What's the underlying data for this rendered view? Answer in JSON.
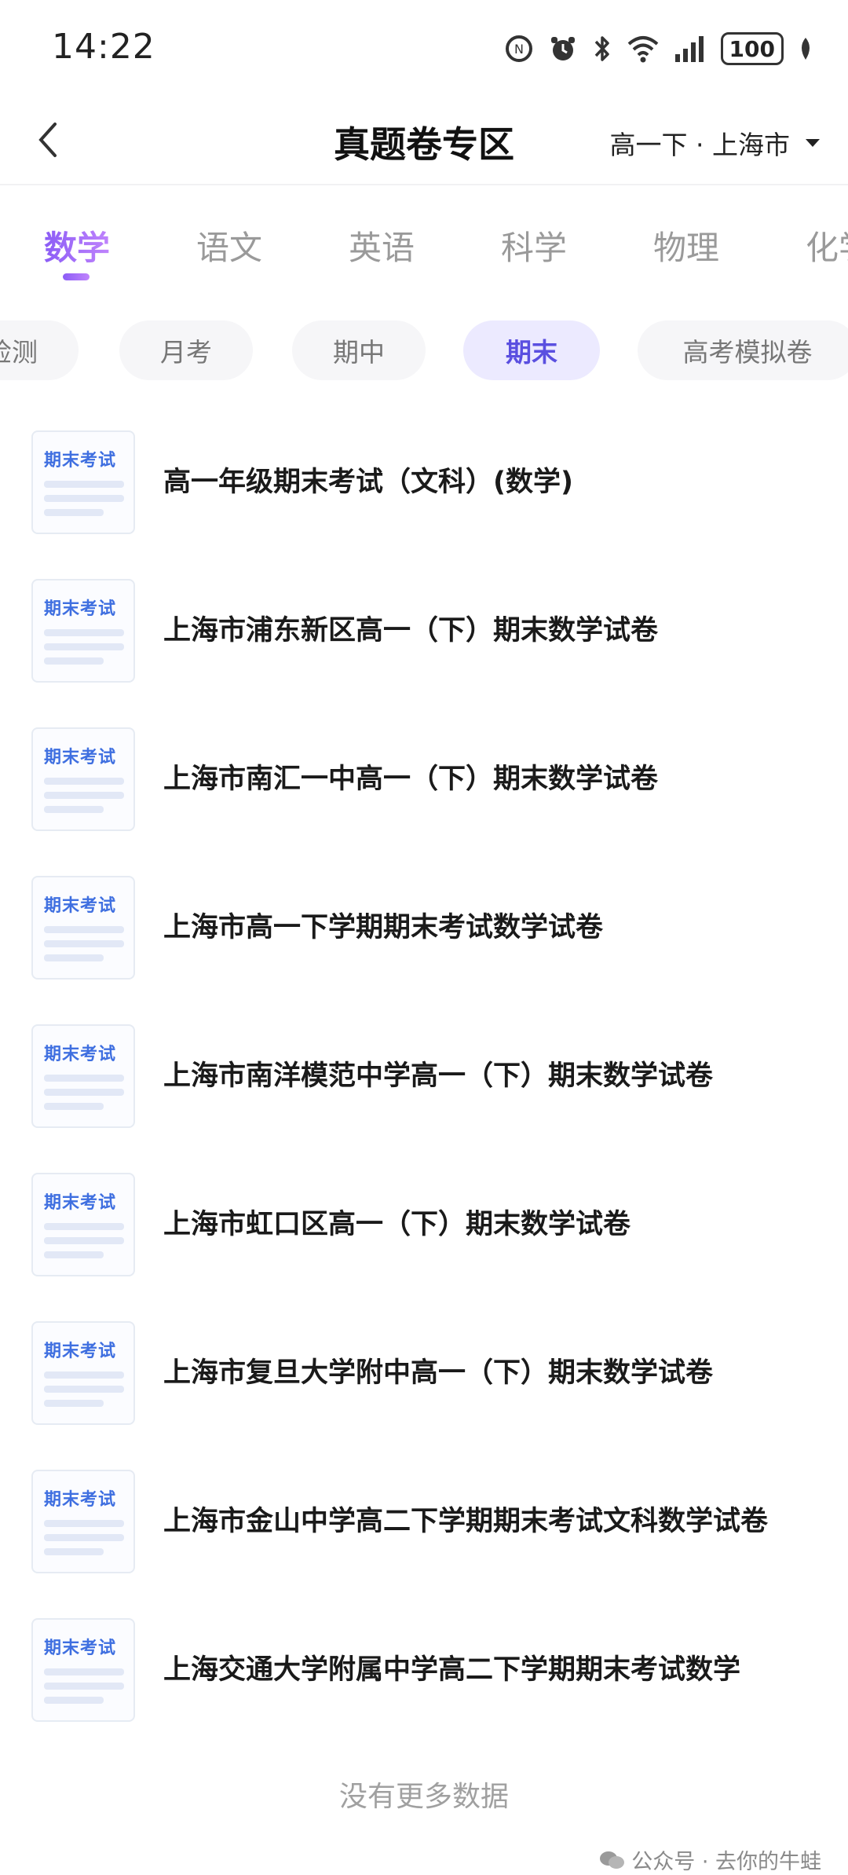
{
  "status_bar": {
    "time": "14:22",
    "battery": "100"
  },
  "header": {
    "title": "真题卷专区",
    "region": "高一下 · 上海市"
  },
  "subjects": [
    "数学",
    "语文",
    "英语",
    "科学",
    "物理",
    "化学"
  ],
  "active_subject": "数学",
  "filters": [
    "检测",
    "月考",
    "期中",
    "期末",
    "高考模拟卷"
  ],
  "active_filter": "期末",
  "thumbnail_label": "期末考试",
  "papers": [
    "高一年级期末考试（文科）(数学)",
    "上海市浦东新区高一（下）期末数学试卷",
    "上海市南汇一中高一（下）期末数学试卷",
    "上海市高一下学期期末考试数学试卷",
    "上海市南洋模范中学高一（下）期末数学试卷",
    "上海市虹口区高一（下）期末数学试卷",
    "上海市复旦大学附中高一（下）期末数学试卷",
    "上海市金山中学高二下学期期末考试文科数学试卷",
    "上海交通大学附属中学高二下学期期末考试数学"
  ],
  "footer": {
    "no_more": "没有更多数据",
    "watermark": "公众号 · 去你的牛蛙"
  },
  "colors": {
    "accent": "#8b5cf6",
    "active_chip_text": "#5a4fe0",
    "thumb_label": "#3f6fe0"
  }
}
